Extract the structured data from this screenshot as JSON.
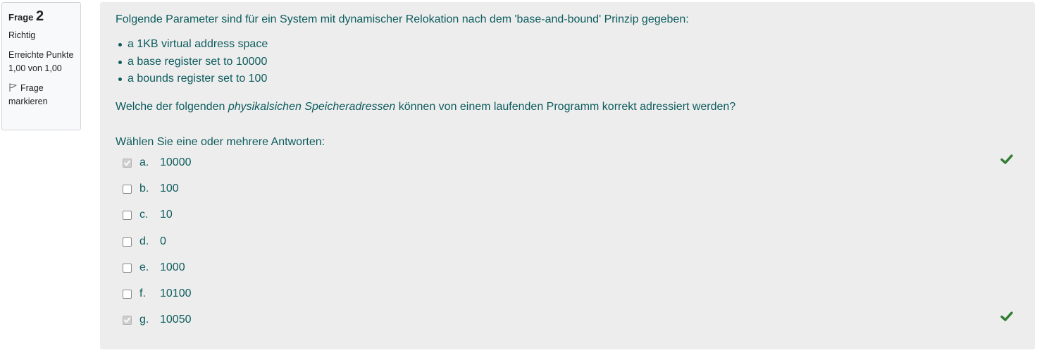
{
  "info": {
    "frage_label": "Frage",
    "frage_number": "2",
    "state": "Richtig",
    "grade": "Erreichte Punkte 1,00 von 1,00",
    "flag_label": "Frage markieren"
  },
  "question": {
    "intro": "Folgende Parameter sind für ein System mit dynamischer Relokation nach dem 'base-and-bound' Prinzip gegeben:",
    "params": [
      "a 1KB virtual address space",
      "a base register set to 10000",
      "a bounds register set to 100"
    ],
    "text_before": "Welche der folgenden ",
    "text_emphasis": "physikalsichen Speicheradressen",
    "text_after": " können von einem laufenden Programm korrekt adressiert werden?",
    "prompt": "Wählen Sie eine oder mehrere Antworten:"
  },
  "answers": [
    {
      "letter": "a.",
      "value": "10000",
      "checked": true,
      "correct": true
    },
    {
      "letter": "b.",
      "value": "100",
      "checked": false,
      "correct": false
    },
    {
      "letter": "c.",
      "value": "10",
      "checked": false,
      "correct": false
    },
    {
      "letter": "d.",
      "value": "0",
      "checked": false,
      "correct": false
    },
    {
      "letter": "e.",
      "value": "1000",
      "checked": false,
      "correct": false
    },
    {
      "letter": "f.",
      "value": "10100",
      "checked": false,
      "correct": false
    },
    {
      "letter": "g.",
      "value": "10050",
      "checked": true,
      "correct": true
    }
  ],
  "colors": {
    "text": "#0d5c5e",
    "tick": "#2e7d32",
    "panel_bg": "#ededed"
  },
  "icons": {
    "flag": "flag-icon",
    "tick": "check-icon"
  }
}
